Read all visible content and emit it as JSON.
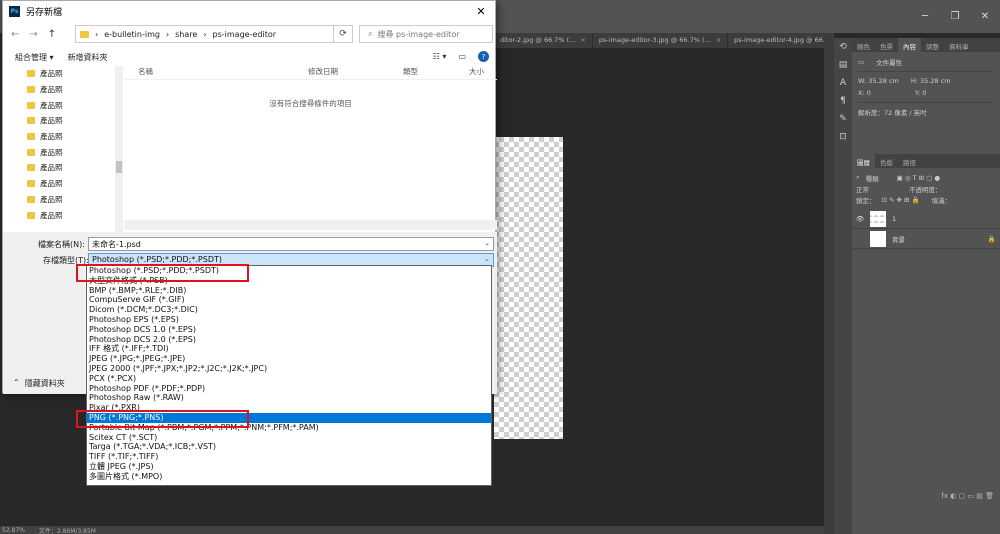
{
  "photoshop": {
    "doc_tabs": [
      {
        "label": "ditor-2.jpg @ 66.7% (...",
        "close": "×"
      },
      {
        "label": "ps-image-editor-3.jpg @ 66.7% (...",
        "close": "×"
      },
      {
        "label": "ps-image-editor-4.jpg @ 66.7% (...",
        "close": "×"
      }
    ],
    "status_zoom": "52.87%",
    "status_doc": "文件：2.86M/3.85M",
    "panel_tabs": [
      "顏色",
      "色票",
      "內容",
      "調整",
      "資料庫"
    ],
    "props_title": "文件屬性",
    "props_w": "W: 35.28 cm",
    "props_h": "H: 35.28 cm",
    "props_x": "X: 0",
    "props_y": "Y: 0",
    "props_res": "解析度：72 像素 / 英吋",
    "layer_tabs": [
      "圖層",
      "色版",
      "路徑"
    ],
    "layer_filter": "種類",
    "blend_mode": "正常",
    "opacity_label": "不透明度：",
    "lock_label": "鎖定：",
    "fill_label": "填滿：",
    "layers": [
      {
        "name": "1",
        "vis": "👁",
        "lock": ""
      },
      {
        "name": "背景",
        "vis": "",
        "lock": "🔒"
      }
    ],
    "layer_icons": "fx ◐ ▢ ▭ ▤ 🗑"
  },
  "dialog": {
    "title": "另存新檔",
    "close": "✕",
    "nav": {
      "back": "←",
      "forward": "→",
      "up": "↑"
    },
    "address": [
      "e-bulletin-img",
      "share",
      "ps-image-editor"
    ],
    "address_sep": "›",
    "search_placeholder": "搜尋 ps-image-editor",
    "toolbar": {
      "organize": "組合管理 ▾",
      "new_folder": "新增資料夾"
    },
    "nav_items": [
      "產品照",
      "產品照",
      "產品照",
      "產品照",
      "產品照",
      "產品照",
      "產品照",
      "產品照",
      "產品照",
      "產品照"
    ],
    "columns": [
      "名稱",
      "修改日期",
      "類型",
      "大小"
    ],
    "empty_message": "沒有符合搜尋條件的項目",
    "filename_label": "檔案名稱(N):",
    "filename_value": "未命名-1.psd",
    "filetype_label": "存檔類型(T):",
    "filetype_value": "Photoshop (*.PSD;*.PDD;*.PSDT)",
    "hide_folders": "隱藏資料夾",
    "filetypes": [
      "Photoshop (*.PSD;*.PDD;*.PSDT)",
      "大型文件格式 (*.PSB)",
      "BMP (*.BMP;*.RLE;*.DIB)",
      "CompuServe GIF (*.GIF)",
      "Dicom (*.DCM;*.DC3;*.DIC)",
      "Photoshop EPS (*.EPS)",
      "Photoshop DCS 1.0 (*.EPS)",
      "Photoshop DCS 2.0 (*.EPS)",
      "IFF 格式 (*.IFF;*.TDI)",
      "JPEG (*.JPG;*.JPEG;*.JPE)",
      "JPEG 2000 (*.JPF;*.JPX;*.JP2;*.J2C;*.J2K;*.JPC)",
      "PCX (*.PCX)",
      "Photoshop PDF (*.PDF;*.PDP)",
      "Photoshop Raw (*.RAW)",
      "Pixar (*.PXR)",
      "PNG (*.PNG;*.PNS)",
      "Portable Bit Map (*.PBM;*.PGM;*.PPM;*.PNM;*.PFM;*.PAM)",
      "Scitex CT (*.SCT)",
      "Targa (*.TGA;*.VDA;*.ICB;*.VST)",
      "TIFF (*.TIF;*.TIFF)",
      "立體 JPEG (*.JPS)",
      "多圖片格式 (*.MPO)"
    ],
    "selected_filetype": "PNG (*.PNG;*.PNS)"
  }
}
